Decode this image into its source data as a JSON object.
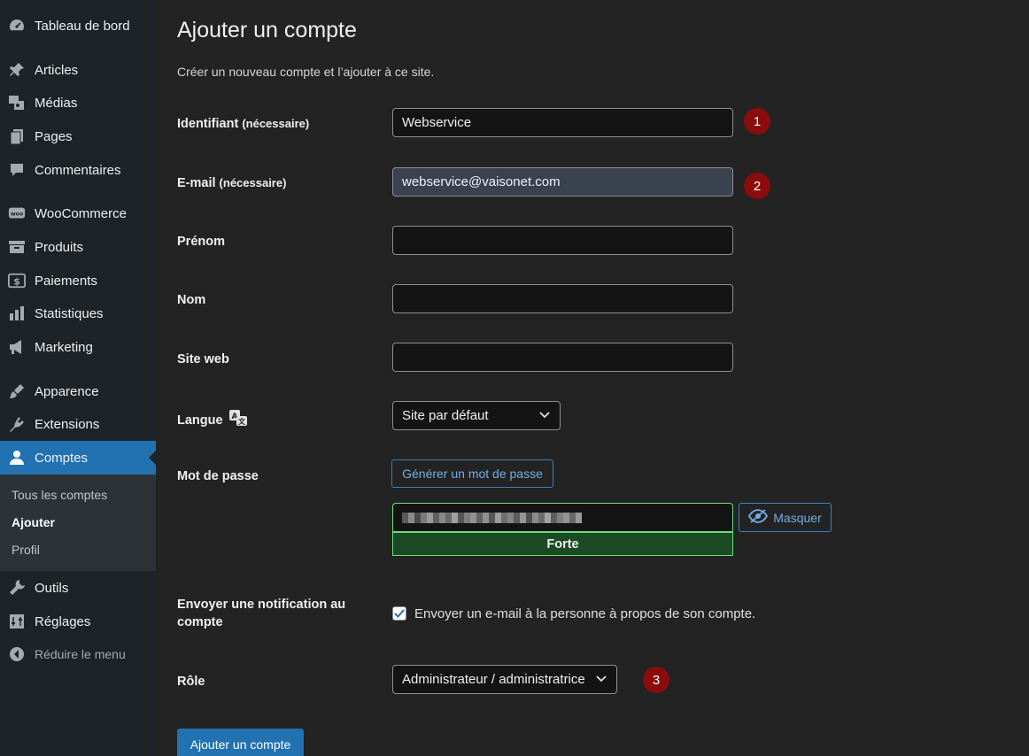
{
  "sidebar": {
    "items": [
      {
        "label": "Tableau de bord",
        "icon": "dashboard-icon"
      },
      {
        "label": "Articles",
        "icon": "pin-icon"
      },
      {
        "label": "Médias",
        "icon": "media-icon"
      },
      {
        "label": "Pages",
        "icon": "pages-icon"
      },
      {
        "label": "Commentaires",
        "icon": "comment-icon"
      },
      {
        "label": "WooCommerce",
        "icon": "woocommerce-icon"
      },
      {
        "label": "Produits",
        "icon": "archive-icon"
      },
      {
        "label": "Paiements",
        "icon": "dollar-icon"
      },
      {
        "label": "Statistiques",
        "icon": "chart-bar-icon"
      },
      {
        "label": "Marketing",
        "icon": "megaphone-icon"
      },
      {
        "label": "Apparence",
        "icon": "brush-icon"
      },
      {
        "label": "Extensions",
        "icon": "plugin-icon"
      },
      {
        "label": "Comptes",
        "icon": "user-icon"
      },
      {
        "label": "Outils",
        "icon": "wrench-icon"
      },
      {
        "label": "Réglages",
        "icon": "settings-icon"
      },
      {
        "label": "Réduire le menu",
        "icon": "collapse-icon"
      }
    ],
    "submenu": [
      {
        "label": "Tous les comptes"
      },
      {
        "label": "Ajouter"
      },
      {
        "label": "Profil"
      }
    ]
  },
  "page": {
    "title": "Ajouter un compte",
    "description": "Créer un nouveau compte et l’ajouter à ce site."
  },
  "form": {
    "username": {
      "label": "Identifiant",
      "req": "(nécessaire)",
      "value": "Webservice",
      "badge": "1"
    },
    "email": {
      "label": "E-mail",
      "req": "(nécessaire)",
      "value": "webservice@vaisonet.com",
      "badge": "2"
    },
    "first_name": {
      "label": "Prénom",
      "value": ""
    },
    "last_name": {
      "label": "Nom",
      "value": ""
    },
    "website": {
      "label": "Site web",
      "value": ""
    },
    "language": {
      "label": "Langue",
      "value": "Site par défaut"
    },
    "password": {
      "label": "Mot de passe",
      "generate_label": "Générer un mot de passe",
      "hide_label": "Masquer",
      "strength": "Forte"
    },
    "notification": {
      "label": "Envoyer une notification au compte",
      "checkbox_label": "Envoyer un e-mail à la personne à propos de son compte.",
      "checked": true
    },
    "role": {
      "label": "Rôle",
      "value": "Administrateur / administratrice",
      "badge": "3"
    },
    "submit_label": "Ajouter un compte"
  },
  "colors": {
    "sidebar_bg": "#1d2327",
    "accent": "#2271b1",
    "badge": "#8a0c0c",
    "strong": "#68de7c"
  }
}
